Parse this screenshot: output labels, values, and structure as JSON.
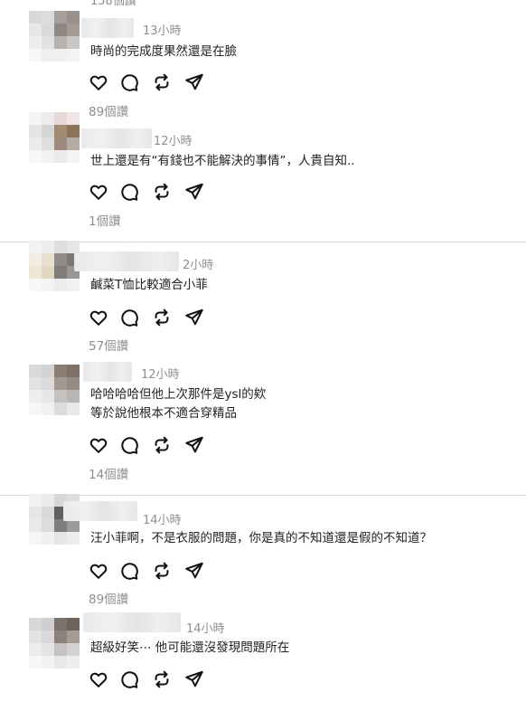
{
  "top_likes": "158個讚",
  "comments": [
    {
      "time": "13小時",
      "lines": [
        "時尚的完成度果然還是在臉"
      ],
      "likes": "89個讚"
    },
    {
      "time": "12小時",
      "lines": [
        "世上還是有“有錢也不能解決的事情”，人貴自知.."
      ],
      "likes": "1個讚"
    },
    {
      "time": "2小時",
      "lines": [
        "鹹菜T恤比較適合小菲"
      ],
      "likes": "57個讚"
    },
    {
      "time": "12小時",
      "lines": [
        "哈哈哈哈但他上次那件是ysl的欸",
        "等於說他根本不適合穿精品"
      ],
      "likes": "14個讚"
    },
    {
      "time": "14小時",
      "lines": [
        "汪小菲啊，不是衣服的問題，你是真的不知道還是假的不知道？"
      ],
      "likes": "89個讚"
    },
    {
      "time": "14小時",
      "lines": [
        "超級好笑⋯ 他可能還沒發現問題所在"
      ],
      "likes": ""
    }
  ],
  "icons": [
    "heart-icon",
    "comment-icon",
    "repost-icon",
    "share-icon"
  ],
  "colors": {
    "muted": "#8e8e8e",
    "divider": "#dbdbdb",
    "text": "#222222"
  }
}
